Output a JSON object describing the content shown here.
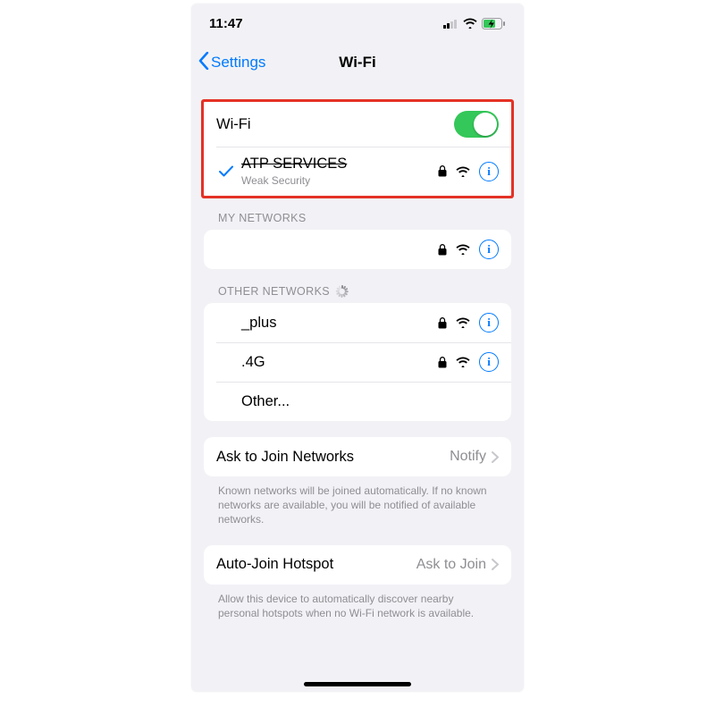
{
  "statusbar": {
    "time": "11:47"
  },
  "nav": {
    "back": "Settings",
    "title": "Wi-Fi"
  },
  "wifi_toggle": {
    "label": "Wi-Fi",
    "on": true
  },
  "connected": {
    "name": "ATP SERVICES",
    "subtitle": "Weak Security"
  },
  "sections": {
    "my_networks_header": "MY NETWORKS",
    "other_networks_header": "OTHER NETWORKS"
  },
  "my_networks": [
    {
      "name": ""
    }
  ],
  "other_networks": [
    {
      "name": "_plus"
    },
    {
      "name": ".4G"
    }
  ],
  "other_row_label": "Other...",
  "ask_join": {
    "label": "Ask to Join Networks",
    "value": "Notify",
    "note": "Known networks will be joined automatically. If no known networks are available, you will be notified of available networks."
  },
  "auto_join": {
    "label": "Auto-Join Hotspot",
    "value": "Ask to Join",
    "note": "Allow this device to automatically discover nearby personal hotspots when no Wi-Fi network is available."
  }
}
